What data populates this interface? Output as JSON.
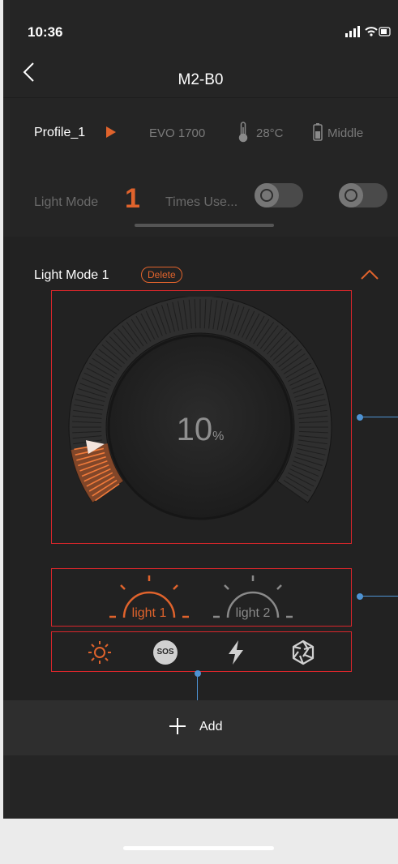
{
  "status_bar": {
    "time": "10:36"
  },
  "header": {
    "title": "M2-B0"
  },
  "profile_bar": {
    "profile": "Profile_1",
    "device": "EVO 1700",
    "temperature": "28°C",
    "battery": "Middle"
  },
  "mode_bar": {
    "label": "Light Mode",
    "number": "1",
    "times_label": "Times Use..."
  },
  "section": {
    "title": "Light Mode 1",
    "delete_label": "Delete",
    "dial": {
      "value": "10",
      "unit": "%",
      "level_fraction": 0.1
    },
    "lights": [
      {
        "label": "light 1",
        "active": true
      },
      {
        "label": "light 2",
        "active": false
      }
    ],
    "modes": [
      "brightness-icon",
      "sos-icon",
      "flash-icon",
      "strobe-icon"
    ],
    "sos_label": "SOS"
  },
  "add": {
    "label": "Add"
  },
  "colors": {
    "accent": "#e0632c",
    "annotation_box": "#d9262b",
    "annotation_line": "#4e93d3"
  }
}
